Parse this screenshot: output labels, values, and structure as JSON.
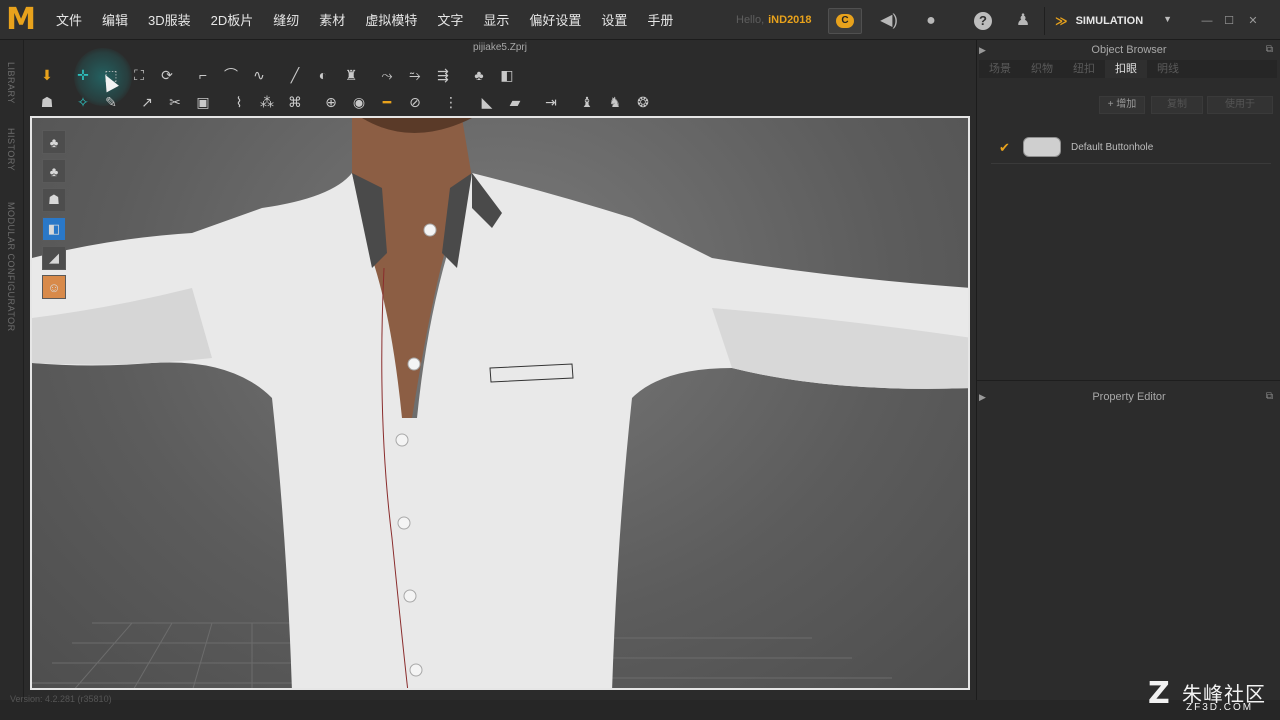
{
  "app": {
    "logo": "M"
  },
  "menu": [
    "文件",
    "编辑",
    "3D服装",
    "2D板片",
    "缝纫",
    "素材",
    "虚拟模特",
    "文字",
    "显示",
    "偏好设置",
    "设置",
    "手册"
  ],
  "header": {
    "greeting": "Hello,",
    "username": "iND2018",
    "mode": "SIMULATION",
    "icons": [
      "cloud-icon",
      "speaker-icon",
      "user-icon",
      "help-icon",
      "avatar-add-icon"
    ]
  },
  "left_strip": [
    "LIBRARY",
    "HISTORY",
    "MODULAR CONFIGURATOR"
  ],
  "viewport": {
    "file_title": "pijiake5.Zprj"
  },
  "toolbar_icons": {
    "row1": [
      "move-down-icon",
      "add-point-icon",
      "select-box-icon",
      "transform-icon",
      "rotate-box-icon",
      "segment-icon",
      "segment-curve-icon",
      "segment-multi-icon",
      "internal-line-icon",
      "fold-icon",
      "garment-icon",
      "sew-line-icon",
      "sew-free-icon",
      "sew-multi-icon",
      "shirt-front-icon",
      "shirt-back-icon"
    ],
    "row2": [
      "avatar-pose-icon",
      "tack-icon",
      "pin-icon",
      "fold-arrange-icon",
      "fold-angle-icon",
      "strengthen-icon",
      "trim-icon",
      "button-set-icon",
      "button-pair-icon",
      "buttonhole-icon",
      "button-icon",
      "topstitch-icon",
      "lock-icon",
      "zipper-icon",
      "pleat-icon",
      "flat-icon",
      "measure-icon",
      "shirt-pin-icon",
      "shirt-fit-icon",
      "fabric-icon"
    ]
  },
  "object_browser": {
    "title": "Object Browser",
    "tabs": [
      "场景",
      "织物",
      "纽扣",
      "扣眼",
      "明线"
    ],
    "active_tab": 3,
    "actions": [
      "+ 增加",
      "复制",
      "使用于"
    ],
    "items": [
      {
        "name": "Default Buttonhole",
        "checked": true
      }
    ]
  },
  "property_editor": {
    "title": "Property Editor"
  },
  "status": {
    "version": "Version: 4.2.281 (r35810)"
  },
  "watermark": {
    "text": "朱峰社区",
    "url": "ZF3D.COM"
  },
  "colors": {
    "accent": "#e8a21c",
    "tool_teal": "#2ec2c0"
  }
}
